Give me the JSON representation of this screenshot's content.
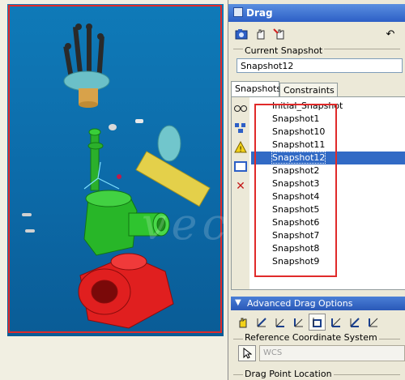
{
  "window": {
    "title": "Drag"
  },
  "toolbar": {
    "buttons": [
      {
        "name": "save-snapshot",
        "icon": "camera-icon"
      },
      {
        "name": "drag-hand",
        "icon": "hand-icon"
      },
      {
        "name": "drag-hand-cross",
        "icon": "hand-remove-icon"
      },
      {
        "name": "undo",
        "icon": "undo-icon",
        "glyph": "↶"
      }
    ]
  },
  "current_snapshot": {
    "label": "Current Snapshot",
    "value": "Snapshot12"
  },
  "tabs": [
    {
      "label": "Snapshots",
      "active": true
    },
    {
      "label": "Constraints",
      "active": false
    }
  ],
  "snapshots": {
    "items": [
      "Initial_Snapshot",
      "Snapshot1",
      "Snapshot10",
      "Snapshot11",
      "Snapshot12",
      "Snapshot2",
      "Snapshot3",
      "Snapshot4",
      "Snapshot5",
      "Snapshot6",
      "Snapshot7",
      "Snapshot8",
      "Snapshot9"
    ],
    "selected": "Snapshot12"
  },
  "side_icons": [
    "glasses-icon",
    "explode-icon",
    "warning-icon",
    "display-icon",
    "delete-icon"
  ],
  "advanced": {
    "title": "Advanced Drag Options",
    "reference_label": "Reference Coordinate System",
    "reference_value": "WCS",
    "drag_point_label": "Drag Point Location"
  },
  "watermark": "vecive",
  "colors": {
    "accent": "#316ac5",
    "highlight": "#e02a2a",
    "title_bar": "#2d5fc6"
  }
}
